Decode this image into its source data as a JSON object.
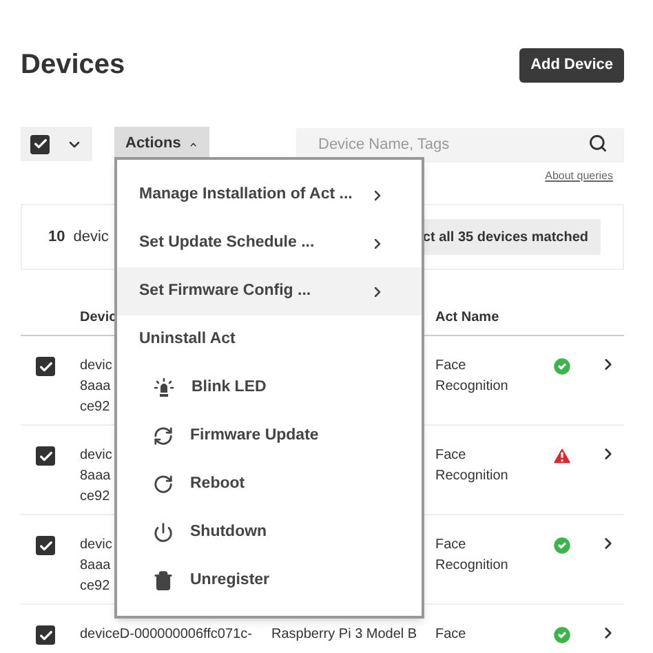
{
  "title": "Devices",
  "add_button": "Add Device",
  "toolbar": {
    "select_all_checked": true,
    "actions": {
      "label": "Actions",
      "expanded": true
    },
    "search": {
      "placeholder": "Device Name, Tags"
    },
    "about_link": "About queries"
  },
  "selection_banner": {
    "count": "10",
    "text": "devic",
    "select_all_button": "ct all 35 devices matched"
  },
  "table": {
    "columns": [
      "Devic",
      "Act Name"
    ],
    "rows": [
      {
        "checked": true,
        "device_lines": [
          "devic",
          "8aaa",
          "ce92"
        ],
        "model": "",
        "act_name": "Face Recognition",
        "warning": false
      },
      {
        "checked": true,
        "device_lines": [
          "devic",
          "8aaa",
          "ce92"
        ],
        "model": "",
        "act_name": "Face Recognition",
        "warning": true
      },
      {
        "checked": true,
        "device_lines": [
          "devic",
          "8aaa",
          "ce92"
        ],
        "model": "",
        "act_name": "Face Recognition",
        "warning": false
      },
      {
        "checked": true,
        "device_lines": [
          "deviceD-000000006ffc071c-"
        ],
        "model": "Raspberry Pi 3 Model B",
        "act_name": "Face",
        "warning": false
      }
    ]
  },
  "actions_menu": [
    {
      "kind": "submenu",
      "label": "Manage Installation of Act ...",
      "highlighted": false
    },
    {
      "kind": "submenu",
      "label": "Set Update Schedule ...",
      "highlighted": false
    },
    {
      "kind": "submenu",
      "label": "Set Firmware Config ...",
      "highlighted": true
    },
    {
      "kind": "plain",
      "label": "Uninstall Act",
      "highlighted": false
    },
    {
      "kind": "blink",
      "label": "Blink LED",
      "highlighted": false
    },
    {
      "kind": "update",
      "label": "Firmware Update",
      "highlighted": false
    },
    {
      "kind": "reboot",
      "label": "Reboot",
      "highlighted": false
    },
    {
      "kind": "shutdown",
      "label": "Shutdown",
      "highlighted": false
    },
    {
      "kind": "unregister",
      "label": "Unregister",
      "highlighted": false
    }
  ]
}
